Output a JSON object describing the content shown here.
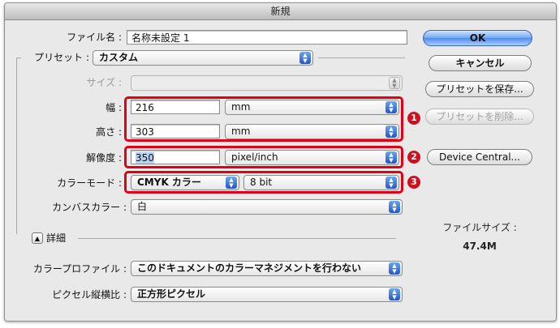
{
  "window": {
    "title": "新規"
  },
  "form": {
    "filename": {
      "label": "ファイル名 :",
      "value": "名称未設定 1"
    },
    "preset": {
      "label": "プリセット :",
      "value": "カスタム"
    },
    "size": {
      "label": "サイズ :",
      "value": ""
    },
    "width": {
      "label": "幅 :",
      "value": "216",
      "unit": "mm"
    },
    "height": {
      "label": "高さ :",
      "value": "303",
      "unit": "mm"
    },
    "resolution": {
      "label": "解像度 :",
      "value": "350",
      "unit": "pixel/inch"
    },
    "color_mode": {
      "label": "カラーモード :",
      "value": "CMYK カラー",
      "depth": "8 bit"
    },
    "canvas_color": {
      "label": "カンバスカラー :",
      "value": "白"
    },
    "advanced": {
      "label": "詳細"
    },
    "color_profile": {
      "label": "カラープロファイル :",
      "value": "このドキュメントのカラーマネジメントを行わない"
    },
    "pixel_aspect": {
      "label": "ピクセル縦横比 :",
      "value": "正方形ピクセル"
    }
  },
  "buttons": {
    "ok": "OK",
    "cancel": "キャンセル",
    "save_preset": "プリセットを保存...",
    "delete_preset": "プリセットを削除...",
    "device_central": "Device Central..."
  },
  "file_size": {
    "label": "ファイルサイズ :",
    "value": "47.4M"
  },
  "annotations": {
    "badge1": "1",
    "badge2": "2",
    "badge3": "3"
  },
  "colors": {
    "highlight": "#e10014",
    "accent": "#4f8cef"
  }
}
